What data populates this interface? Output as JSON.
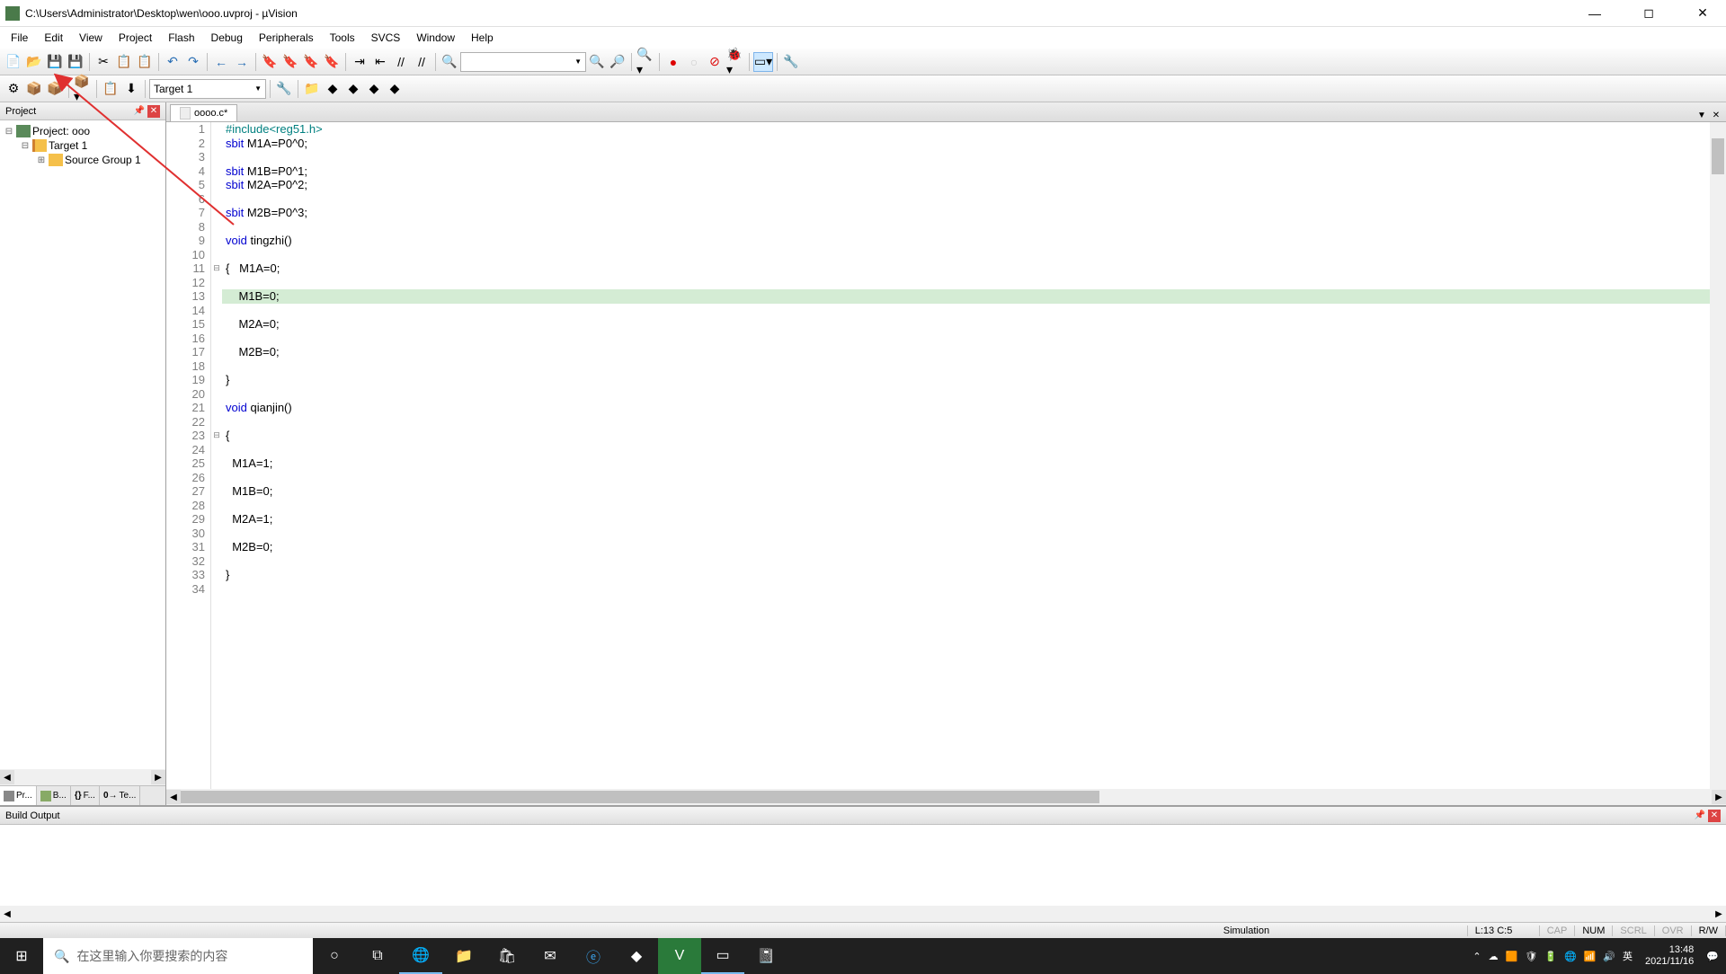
{
  "window": {
    "title": "C:\\Users\\Administrator\\Desktop\\wen\\ooo.uvproj - µVision"
  },
  "menu": [
    "File",
    "Edit",
    "View",
    "Project",
    "Flash",
    "Debug",
    "Peripherals",
    "Tools",
    "SVCS",
    "Window",
    "Help"
  ],
  "toolbar2": {
    "target": "Target 1"
  },
  "project_panel": {
    "title": "Project",
    "root": "Project: ooo",
    "target": "Target 1",
    "group": "Source Group 1",
    "tabs": [
      "Pr...",
      "B...",
      "F...",
      "Te..."
    ]
  },
  "editor": {
    "tab": "oooo.c*",
    "highlight_line": 13,
    "lines": [
      {
        "n": 1,
        "html": "<span class='pp'>#include</span><span class='str'>&lt;reg51.h&gt;</span>"
      },
      {
        "n": 2,
        "html": "<span class='kw'>sbit</span> M1A=P0^0;"
      },
      {
        "n": 3,
        "html": ""
      },
      {
        "n": 4,
        "html": "<span class='kw'>sbit</span> M1B=P0^1;"
      },
      {
        "n": 5,
        "html": "<span class='kw'>sbit</span> M2A=P0^2;"
      },
      {
        "n": 6,
        "html": ""
      },
      {
        "n": 7,
        "html": "<span class='kw'>sbit</span> M2B=P0^3;"
      },
      {
        "n": 8,
        "html": ""
      },
      {
        "n": 9,
        "html": "<span class='kw'>void</span> tingzhi()"
      },
      {
        "n": 10,
        "html": ""
      },
      {
        "n": 11,
        "html": "{   M1A=0;",
        "fold": "⊟"
      },
      {
        "n": 12,
        "html": ""
      },
      {
        "n": 13,
        "html": "    M1B=0;"
      },
      {
        "n": 14,
        "html": ""
      },
      {
        "n": 15,
        "html": "    M2A=0;"
      },
      {
        "n": 16,
        "html": ""
      },
      {
        "n": 17,
        "html": "    M2B=0;"
      },
      {
        "n": 18,
        "html": ""
      },
      {
        "n": 19,
        "html": "}"
      },
      {
        "n": 20,
        "html": ""
      },
      {
        "n": 21,
        "html": "<span class='kw'>void</span> qianjin()"
      },
      {
        "n": 22,
        "html": ""
      },
      {
        "n": 23,
        "html": "{",
        "fold": "⊟"
      },
      {
        "n": 24,
        "html": ""
      },
      {
        "n": 25,
        "html": "  M1A=1;"
      },
      {
        "n": 26,
        "html": ""
      },
      {
        "n": 27,
        "html": "  M1B=0;"
      },
      {
        "n": 28,
        "html": ""
      },
      {
        "n": 29,
        "html": "  M2A=1;"
      },
      {
        "n": 30,
        "html": ""
      },
      {
        "n": 31,
        "html": "  M2B=0;"
      },
      {
        "n": 32,
        "html": ""
      },
      {
        "n": 33,
        "html": "}"
      },
      {
        "n": 34,
        "html": ""
      }
    ]
  },
  "build_panel": {
    "title": "Build Output"
  },
  "status": {
    "mode": "Simulation",
    "cursor": "L:13 C:5",
    "caps": "CAP",
    "num": "NUM",
    "scrl": "SCRL",
    "ovr": "OVR",
    "rw": "R/W"
  },
  "taskbar": {
    "search_placeholder": "在这里输入你要搜索的内容",
    "time": "13:48",
    "date": "2021/11/16",
    "ime": "英"
  }
}
